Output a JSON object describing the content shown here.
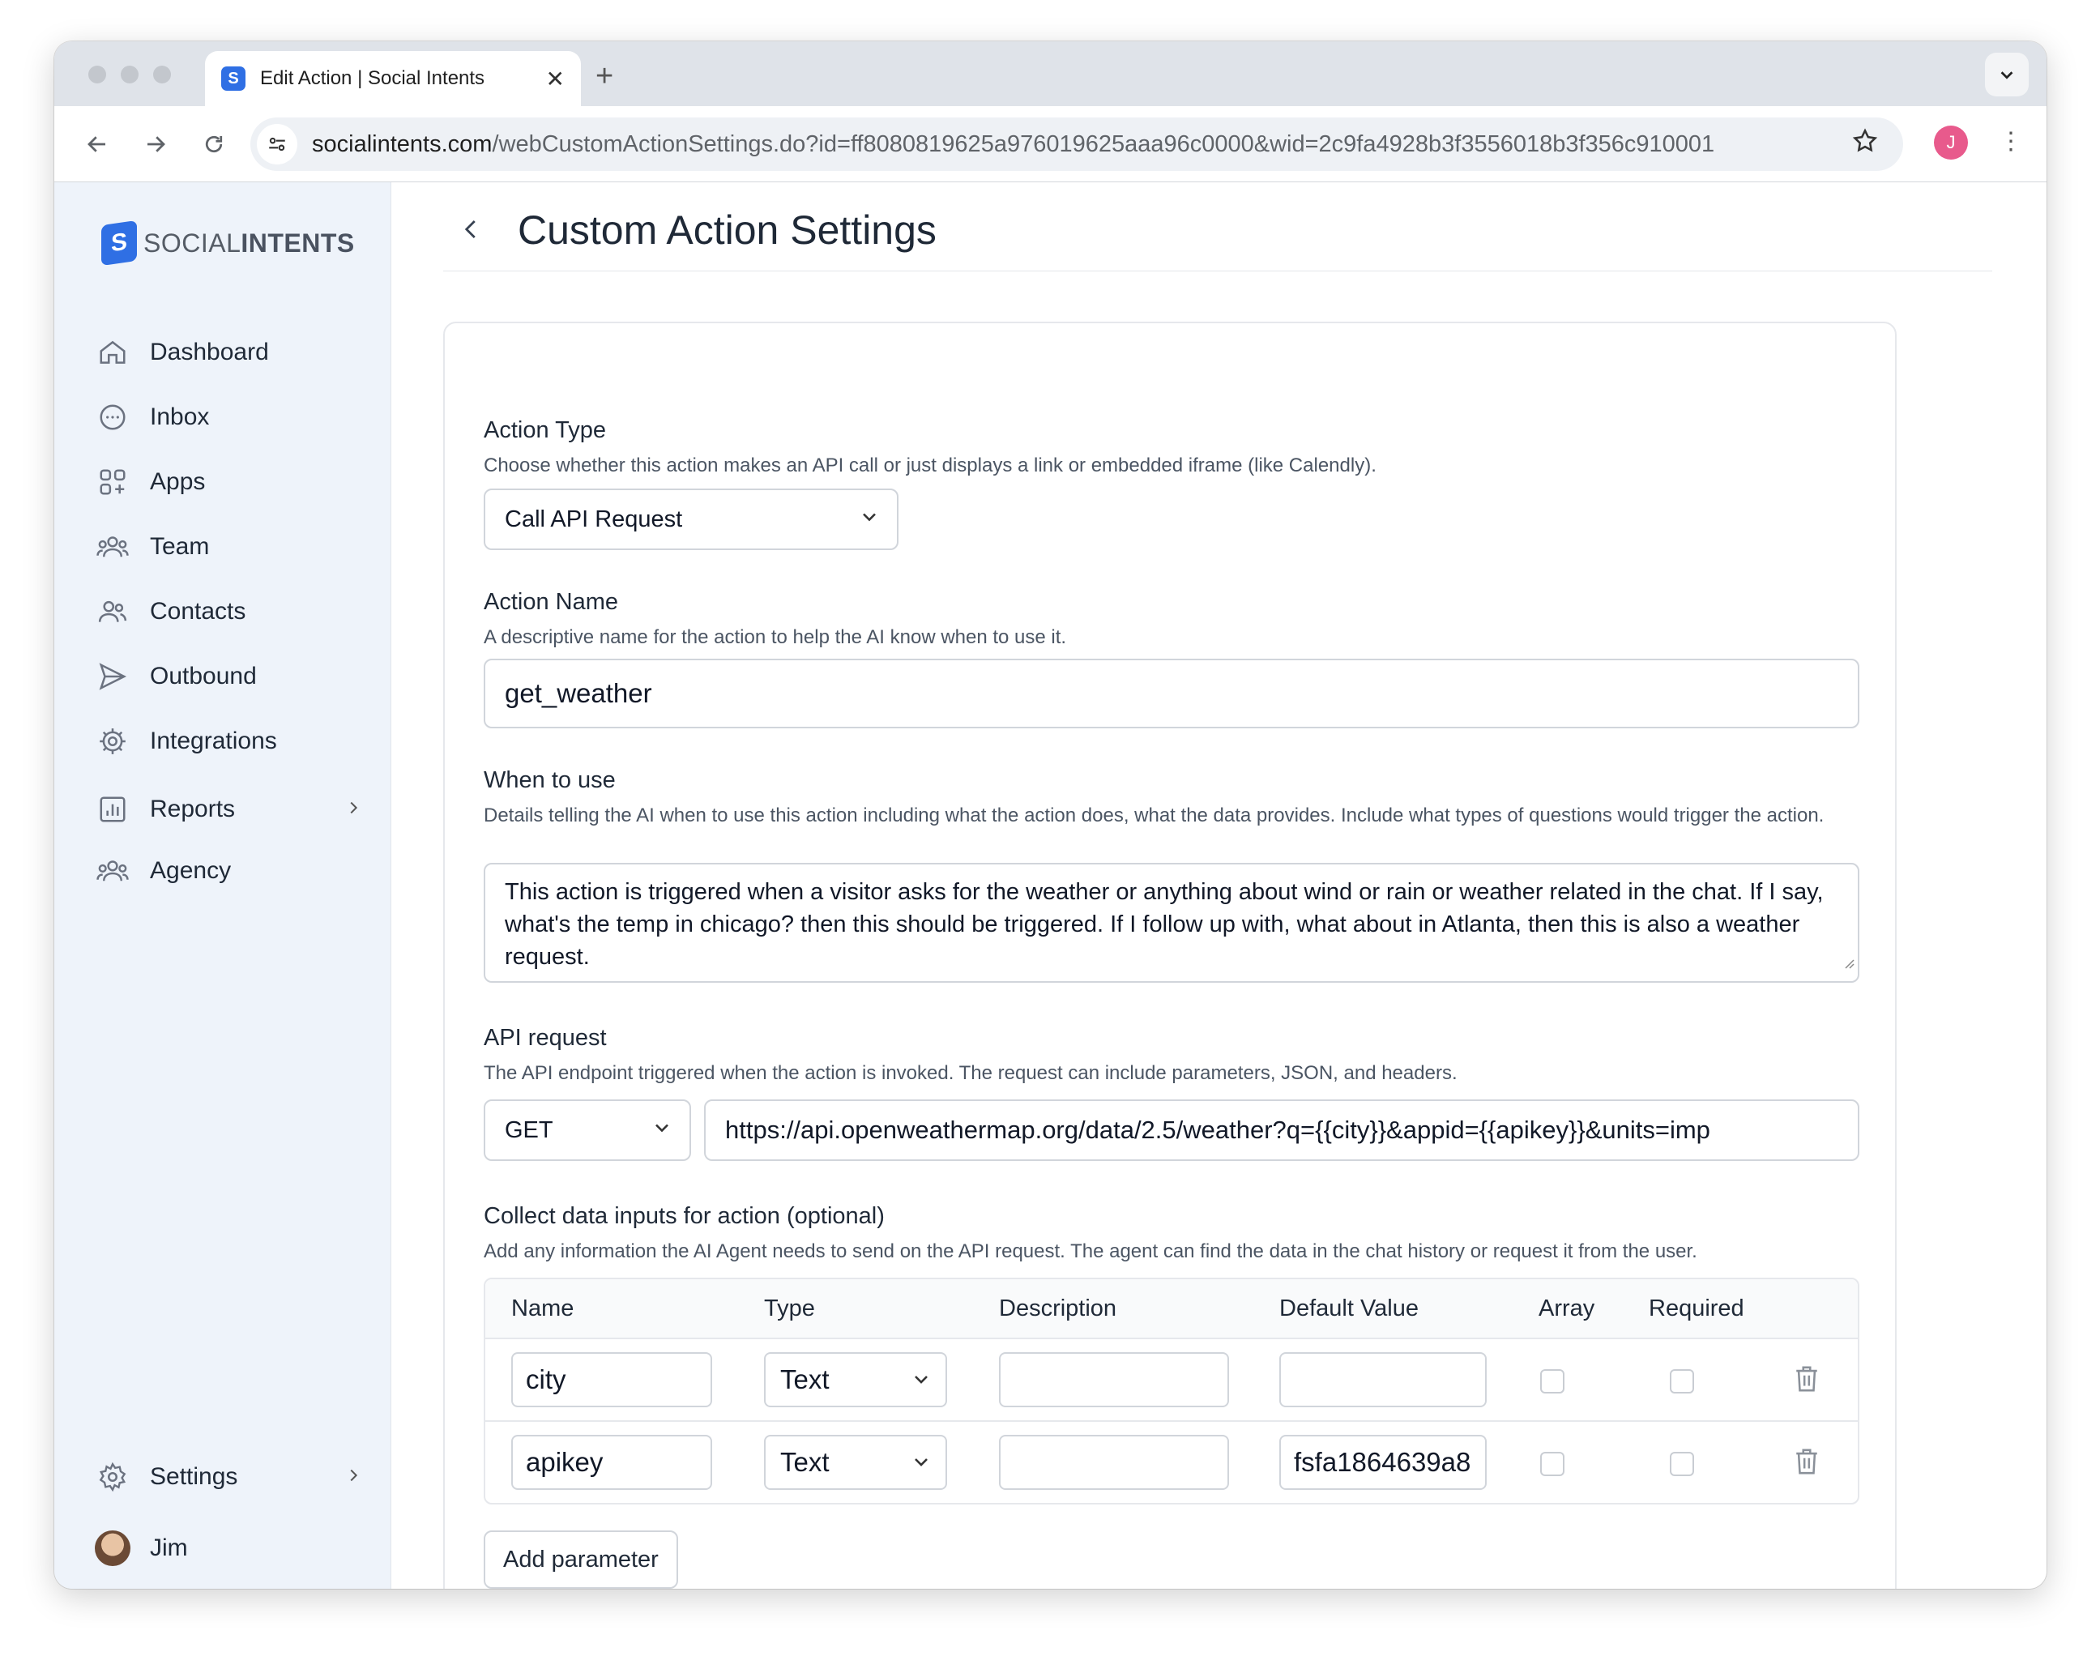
{
  "browser": {
    "tab_title": "Edit Action | Social Intents",
    "url_domain": "socialintents.com",
    "url_path": "/webCustomActionSettings.do?id=ff8080819625a976019625aaa96c0000&wid=2c9fa4928b3f3556018b3f356c910001",
    "profile_initial": "J"
  },
  "sidebar": {
    "logo_prefix": "SOCIAL",
    "logo_suffix": "INTENTS",
    "items": [
      {
        "label": "Dashboard",
        "icon": "home-icon"
      },
      {
        "label": "Inbox",
        "icon": "chat-bubble-icon"
      },
      {
        "label": "Apps",
        "icon": "apps-grid-icon"
      },
      {
        "label": "Team",
        "icon": "team-icon"
      },
      {
        "label": "Contacts",
        "icon": "contacts-icon"
      },
      {
        "label": "Outbound",
        "icon": "send-icon"
      },
      {
        "label": "Integrations",
        "icon": "integrations-gear-icon"
      },
      {
        "label": "Reports",
        "icon": "bar-chart-icon"
      },
      {
        "label": "Agency",
        "icon": "agency-icon"
      }
    ],
    "settings_label": "Settings",
    "user_name": "Jim"
  },
  "page": {
    "title": "Custom Action Settings"
  },
  "form": {
    "action_type": {
      "label": "Action Type",
      "help": "Choose whether this action makes an API call or just displays a link or embedded iframe (like Calendly).",
      "value": "Call API Request"
    },
    "action_name": {
      "label": "Action Name",
      "help": "A descriptive name for the action to help the AI know when to use it.",
      "value": "get_weather"
    },
    "when_to_use": {
      "label": "When to use",
      "help": "Details telling the AI when to use this action including what the action does, what the data provides. Include what types of questions would trigger the action.",
      "value": "This action is triggered when a visitor asks for the weather or anything about wind or rain or weather related in the chat.  If I say, what's the temp in chicago?  then this should be triggered.  If I follow up with, what about in Atlanta, then this is also a weather request."
    },
    "api_request": {
      "label": "API request",
      "help": "The API endpoint triggered when the action is invoked. The request can include parameters, JSON, and headers.",
      "method": "GET",
      "url": "https://api.openweathermap.org/data/2.5/weather?q={{city}}&appid={{apikey}}&units=imp"
    },
    "data_inputs": {
      "label": "Collect data inputs for action (optional)",
      "help": "Add any information the AI Agent needs to send on the API request. The agent can find the data in the chat history or request it from the user.",
      "columns": [
        "Name",
        "Type",
        "Description",
        "Default Value",
        "Array",
        "Required"
      ],
      "rows": [
        {
          "name": "city",
          "type": "Text",
          "description": "",
          "default_value": "",
          "array": false,
          "required": false
        },
        {
          "name": "apikey",
          "type": "Text",
          "description": "",
          "default_value": "fsfa1864639a8",
          "array": false,
          "required": false
        }
      ],
      "add_button": "Add parameter"
    }
  }
}
